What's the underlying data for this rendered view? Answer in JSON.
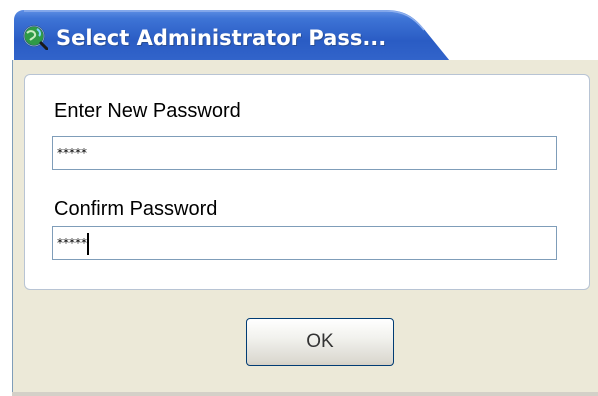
{
  "window": {
    "title": "Select Administrator Pass...",
    "icon": "globe-magnifier-icon",
    "title_color": "#ffffff",
    "titlebar_color": "#3a6fd0"
  },
  "form": {
    "new_password_label": "Enter New Password",
    "new_password_value": "*****",
    "confirm_password_label": "Confirm Password",
    "confirm_password_value": "*****"
  },
  "actions": {
    "ok_label": "OK"
  }
}
